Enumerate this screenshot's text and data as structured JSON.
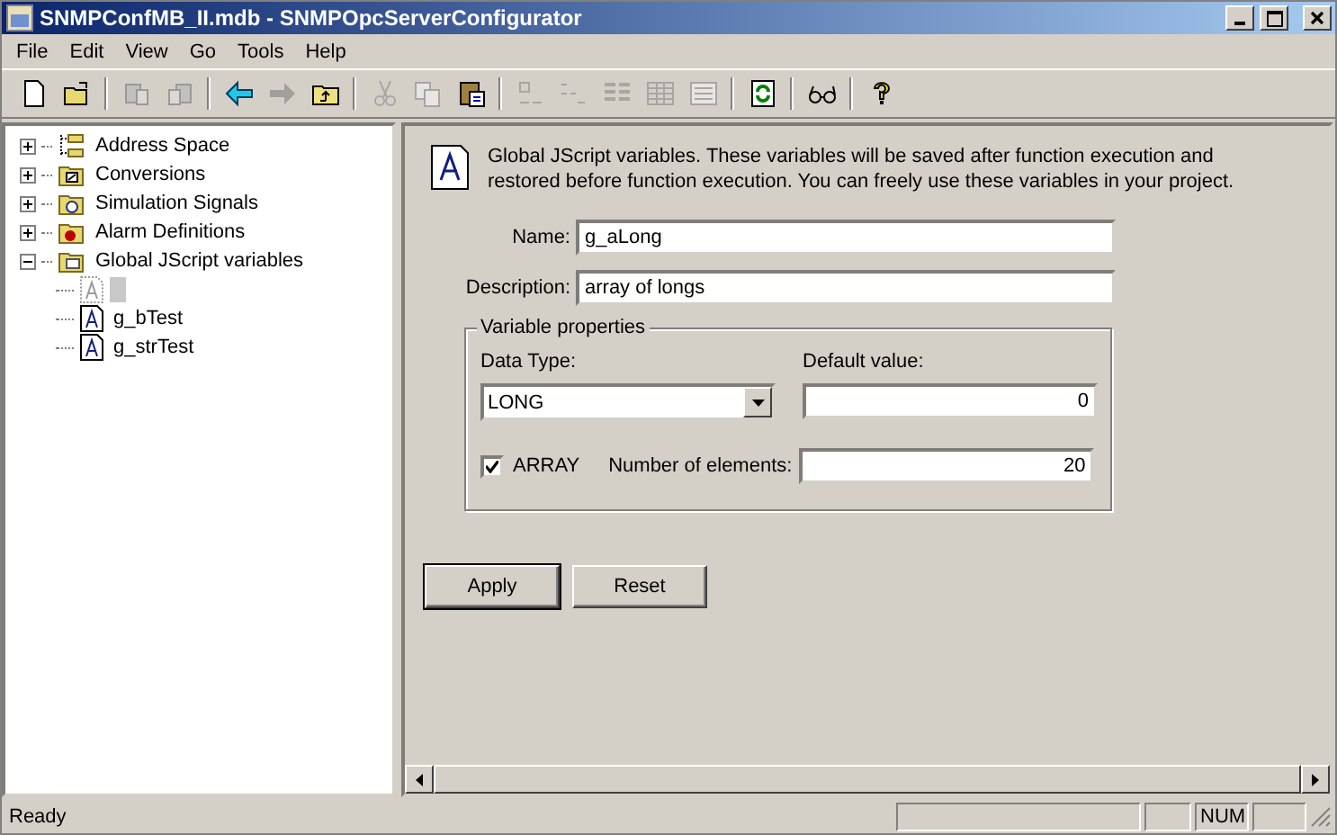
{
  "window": {
    "title": "SNMPConfMB_II.mdb - SNMPOpcServerConfigurator"
  },
  "menu": [
    "File",
    "Edit",
    "View",
    "Go",
    "Tools",
    "Help"
  ],
  "toolbar": [
    {
      "kind": "new",
      "disabled": false
    },
    {
      "kind": "open",
      "disabled": false
    },
    {
      "kind": "separator"
    },
    {
      "kind": "db-export",
      "disabled": true
    },
    {
      "kind": "db-import",
      "disabled": true
    },
    {
      "kind": "separator"
    },
    {
      "kind": "back",
      "disabled": false
    },
    {
      "kind": "forward",
      "disabled": true
    },
    {
      "kind": "up",
      "disabled": false
    },
    {
      "kind": "separator"
    },
    {
      "kind": "cut",
      "disabled": true
    },
    {
      "kind": "copy",
      "disabled": true
    },
    {
      "kind": "paste",
      "disabled": false
    },
    {
      "kind": "separator"
    },
    {
      "kind": "large-icons",
      "disabled": true
    },
    {
      "kind": "small-icons",
      "disabled": true
    },
    {
      "kind": "list",
      "disabled": true
    },
    {
      "kind": "details",
      "disabled": true
    },
    {
      "kind": "form",
      "disabled": true
    },
    {
      "kind": "separator"
    },
    {
      "kind": "refresh",
      "disabled": false
    },
    {
      "kind": "separator"
    },
    {
      "kind": "find",
      "disabled": false
    },
    {
      "kind": "separator"
    },
    {
      "kind": "help",
      "disabled": false
    }
  ],
  "tree": [
    {
      "label": "Address Space",
      "kind": "space",
      "expanded": false
    },
    {
      "label": "Conversions",
      "kind": "conversions",
      "expanded": false
    },
    {
      "label": "Simulation Signals",
      "kind": "signals",
      "expanded": false
    },
    {
      "label": "Alarm Definitions",
      "kind": "alarms",
      "expanded": false
    },
    {
      "label": "Global JScript variables",
      "kind": "globals",
      "expanded": true,
      "children": [
        {
          "selected": true
        },
        {
          "label": "g_bTest",
          "selected": false
        },
        {
          "label": "g_strTest",
          "selected": false
        }
      ]
    }
  ],
  "panel": {
    "description": "Global JScript variables. These variables will be saved after function execution and restored before function execution. You can freely use these variables in your project.",
    "fields": [
      {
        "label": "Name:",
        "value": "g_aLong"
      },
      {
        "label": "Description:",
        "value": "array of longs"
      }
    ],
    "group": {
      "title": "Variable properties",
      "data_type": {
        "label": "Data Type:",
        "value": "LONG"
      },
      "default_value": {
        "label": "Default value:",
        "value": "0"
      },
      "array": {
        "label": "ARRAY",
        "checked": true
      },
      "elements": {
        "label": "Number of elements:",
        "value": "20"
      }
    },
    "buttons": [
      "Apply",
      "Reset"
    ]
  },
  "status_bar": {
    "text": "Ready",
    "num": "NUM"
  }
}
